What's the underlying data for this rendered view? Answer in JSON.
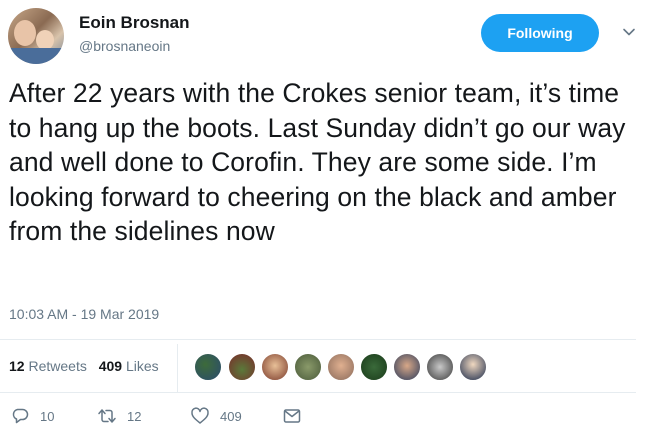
{
  "author": {
    "display_name": "Eoin Brosnan",
    "handle": "@brosnaneoin"
  },
  "follow_button_label": "Following",
  "tweet": {
    "text": "After 22 years with the Crokes senior team, it’s time to hang up the boots. Last Sunday didn’t go our way and well done to Corofin. They are some side. I’m looking forward to cheering on the black and amber from the sidelines now",
    "timestamp": "10:03 AM - 19 Mar 2019"
  },
  "stats": {
    "retweets_count": "12",
    "retweets_label": "Retweets",
    "likes_count": "409",
    "likes_label": "Likes"
  },
  "actions": {
    "reply_count": "10",
    "retweet_count": "12",
    "like_count": "409"
  },
  "icons": [
    "chevron-down-icon",
    "reply-icon",
    "retweet-icon",
    "like-icon",
    "message-icon"
  ],
  "colors": {
    "accent": "#1da1f2",
    "secondary_text": "#657786",
    "primary_text": "#14171a",
    "divider": "#e6ecf0"
  }
}
